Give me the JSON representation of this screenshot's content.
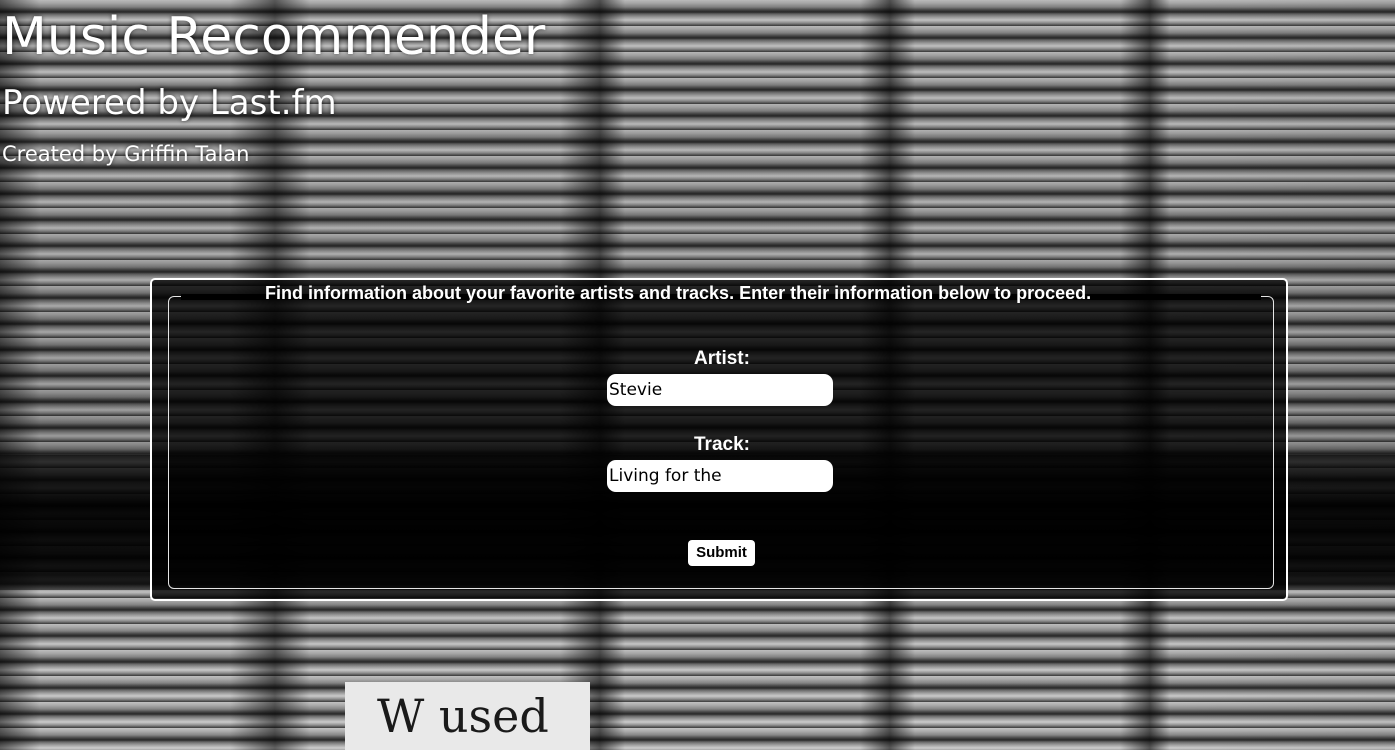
{
  "header": {
    "title": "Music Recommender",
    "subtitle": "Powered by Last.fm",
    "author": "Created by Griffin Talan"
  },
  "form": {
    "legend": "Find information about your favorite artists and tracks. Enter their information below to proceed.",
    "artist_label": "Artist:",
    "artist_value": "Stevie",
    "track_label": "Track:",
    "track_value": "Living for the",
    "submit_label": "Submit"
  },
  "background": {
    "sticker_text": "W  used"
  },
  "colors": {
    "text": "#ffffff",
    "panel_background": "#000000",
    "input_background": "#ffffff"
  }
}
